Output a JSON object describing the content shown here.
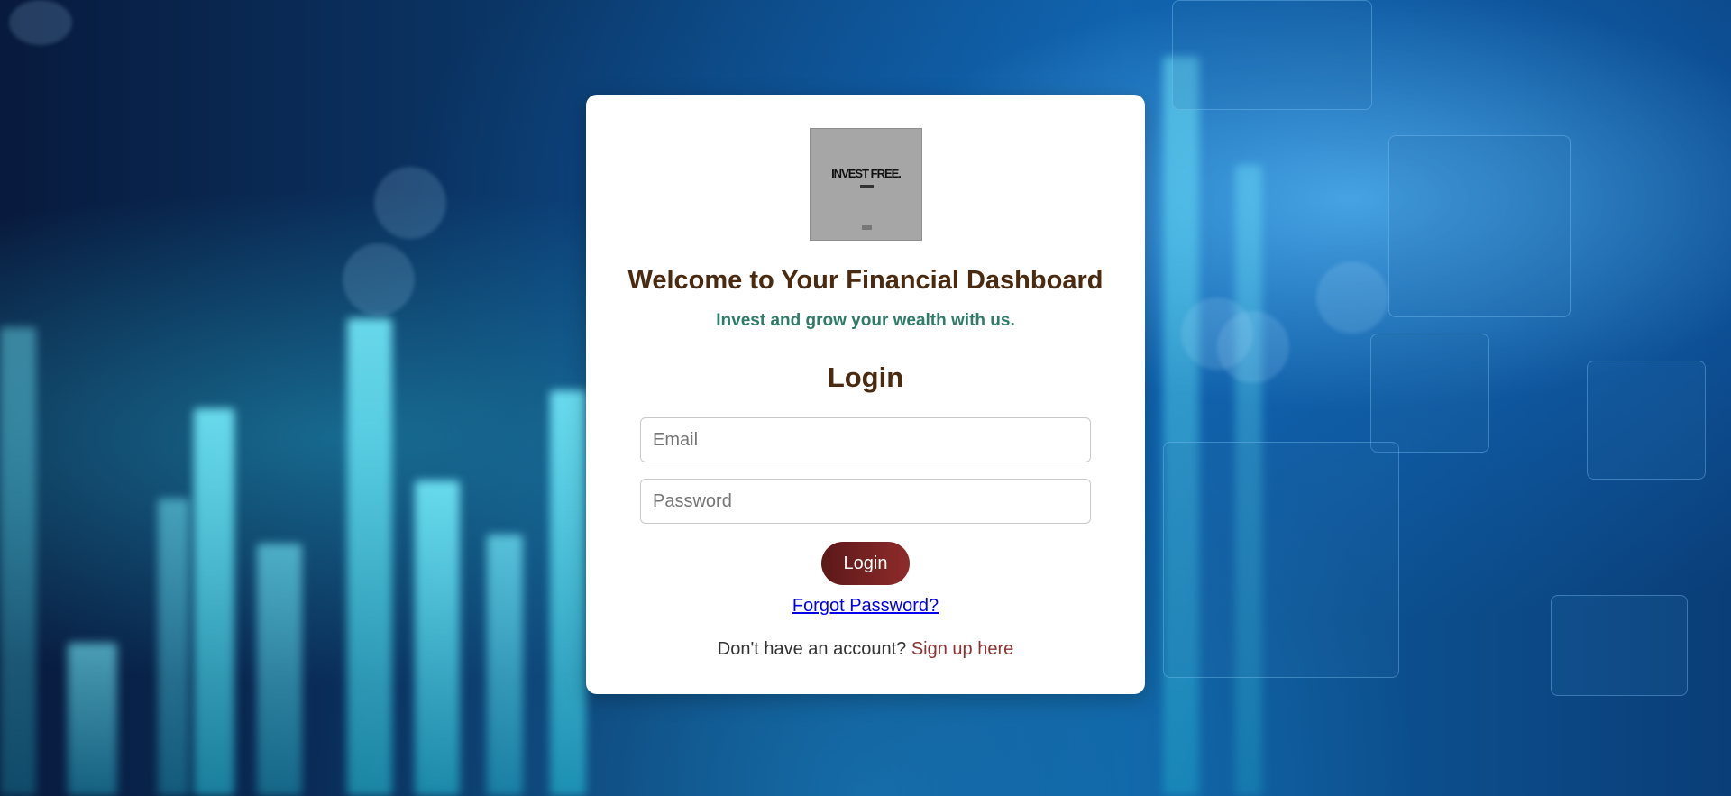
{
  "logo": {
    "text": "INVEST FREE."
  },
  "header": {
    "title": "Welcome to Your Financial Dashboard",
    "subtitle": "Invest and grow your wealth with us."
  },
  "form": {
    "title": "Login",
    "email_placeholder": "Email",
    "email_value": "",
    "password_placeholder": "Password",
    "password_value": "",
    "submit_label": "Login",
    "forgot_label": "Forgot Password?",
    "signup_prompt": "Don't have an account? ",
    "signup_link": "Sign up here"
  },
  "colors": {
    "heading": "#4a2a10",
    "subtitle": "#2e7b68",
    "button": "#7a2424",
    "link": "#0000ee",
    "signup_link": "#8b3232"
  }
}
